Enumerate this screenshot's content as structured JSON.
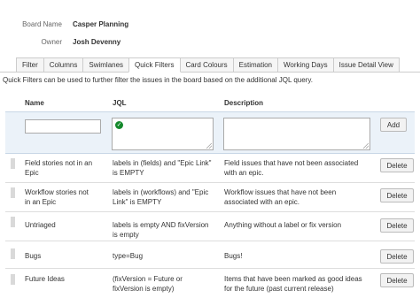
{
  "board": {
    "name_label": "Board Name",
    "name_value": "Casper Planning",
    "owner_label": "Owner",
    "owner_value": "Josh Devenny"
  },
  "tabs": [
    {
      "label": "Filter",
      "active": false
    },
    {
      "label": "Columns",
      "active": false
    },
    {
      "label": "Swimlanes",
      "active": false
    },
    {
      "label": "Quick Filters",
      "active": true
    },
    {
      "label": "Card Colours",
      "active": false
    },
    {
      "label": "Estimation",
      "active": false
    },
    {
      "label": "Working Days",
      "active": false
    },
    {
      "label": "Issue Detail View",
      "active": false
    }
  ],
  "intro_text": "Quick Filters can be used to further filter the issues in the board based on the additional JQL query.",
  "table": {
    "headers": {
      "name": "Name",
      "jql": "JQL",
      "description": "Description"
    },
    "add_button": "Add",
    "delete_label": "Delete",
    "rows": [
      {
        "name": "Field stories not in an Epic",
        "jql": "labels in (fields) and \"Epic Link\" is EMPTY",
        "description": "Field issues that have not been associated with an epic."
      },
      {
        "name": "Workflow stories not in an Epic",
        "jql": "labels in (workflows) and \"Epic Link\" is EMPTY",
        "description": "Workflow issues that have not been associated with an epic."
      },
      {
        "name": "Untriaged",
        "jql": "labels is empty AND fixVersion is empty",
        "description": "Anything without a label or fix version"
      },
      {
        "name": "Bugs",
        "jql": "type=Bug",
        "description": "Bugs!"
      },
      {
        "name": "Future Ideas",
        "jql": "(fixVersion = Future or fixVersion is empty)",
        "description": "Items that have been marked as good ideas for the future (past current release)"
      }
    ]
  },
  "colors": {
    "accent_row": "#ebf2f9",
    "valid_check": "#14892c"
  },
  "icons": {
    "valid": "check-circle-icon"
  }
}
